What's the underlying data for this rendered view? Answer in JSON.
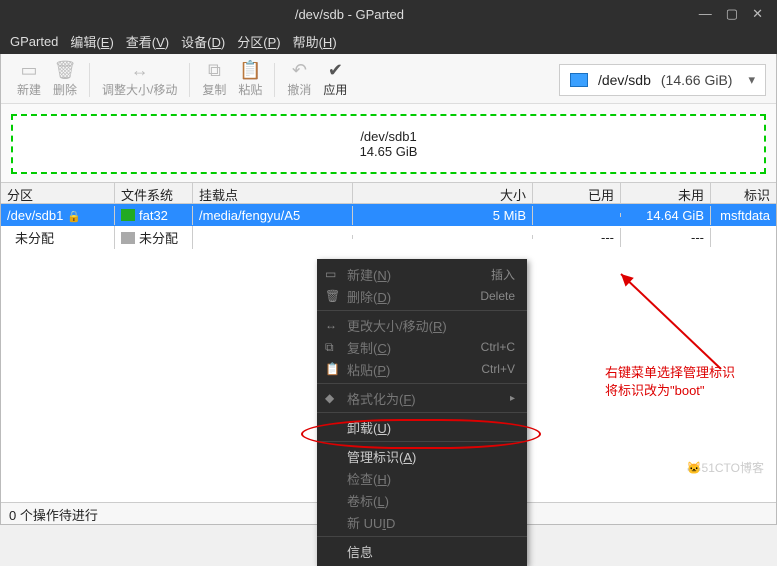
{
  "window": {
    "title": "/dev/sdb - GParted",
    "min": "—",
    "max": "▢",
    "close": "✕"
  },
  "menu": {
    "gparted": "GParted",
    "edit": "编辑(<u>E</u>)",
    "view": "查看(<u>V</u>)",
    "device": "设备(<u>D</u>)",
    "partition": "分区(<u>P</u>)",
    "help": "帮助(<u>H</u>)"
  },
  "toolbar": {
    "new": "新建",
    "delete": "删除",
    "resize": "调整大小/移动",
    "copy": "复制",
    "paste": "粘贴",
    "undo": "撤消",
    "apply": "应用"
  },
  "device_selector": {
    "device": "/dev/sdb",
    "size": "(14.66 GiB)"
  },
  "diskmap": {
    "name": "/dev/sdb1",
    "size": "14.65 GiB"
  },
  "columns": {
    "part": "分区",
    "fs": "文件系统",
    "mnt": "挂载点",
    "size": "大小",
    "used": "已用",
    "free": "未用",
    "flag": "标识"
  },
  "rows": [
    {
      "part": "/dev/sdb1",
      "lock": "🔒",
      "fs": "fat32",
      "mnt": "/media/fengyu/A5",
      "size": "5 MiB",
      "used": "",
      "free": "14.64 GiB",
      "flag": "msftdata"
    },
    {
      "part": "未分配",
      "lock": "",
      "fs": "未分配",
      "mnt": "",
      "size": "",
      "used": "---",
      "free": "---",
      "flag": ""
    }
  ],
  "ctx": {
    "new": "新建(<u>N</u>)",
    "new_sc": "插入",
    "delete": "删除(<u>D</u>)",
    "delete_sc": "Delete",
    "resize": "更改大小/移动(<u>R</u>)",
    "copy": "复制(<u>C</u>)",
    "copy_sc": "Ctrl+C",
    "paste": "粘贴(<u>P</u>)",
    "paste_sc": "Ctrl+V",
    "format": "格式化为(<u>F</u>)",
    "umount": "卸载(<u>U</u>)",
    "flags": "管理标识(<u>A</u>)",
    "check": "检查(<u>H</u>)",
    "label": "卷标(<u>L</u>)",
    "uuid": "新 UU<u>I</u>D",
    "info": "信息"
  },
  "status": "0 个操作待进行",
  "annotation": {
    "line1": "右键菜单选择管理标识",
    "line2": "将标识改为\"boot\""
  },
  "watermark": "🐱51CTO博客"
}
